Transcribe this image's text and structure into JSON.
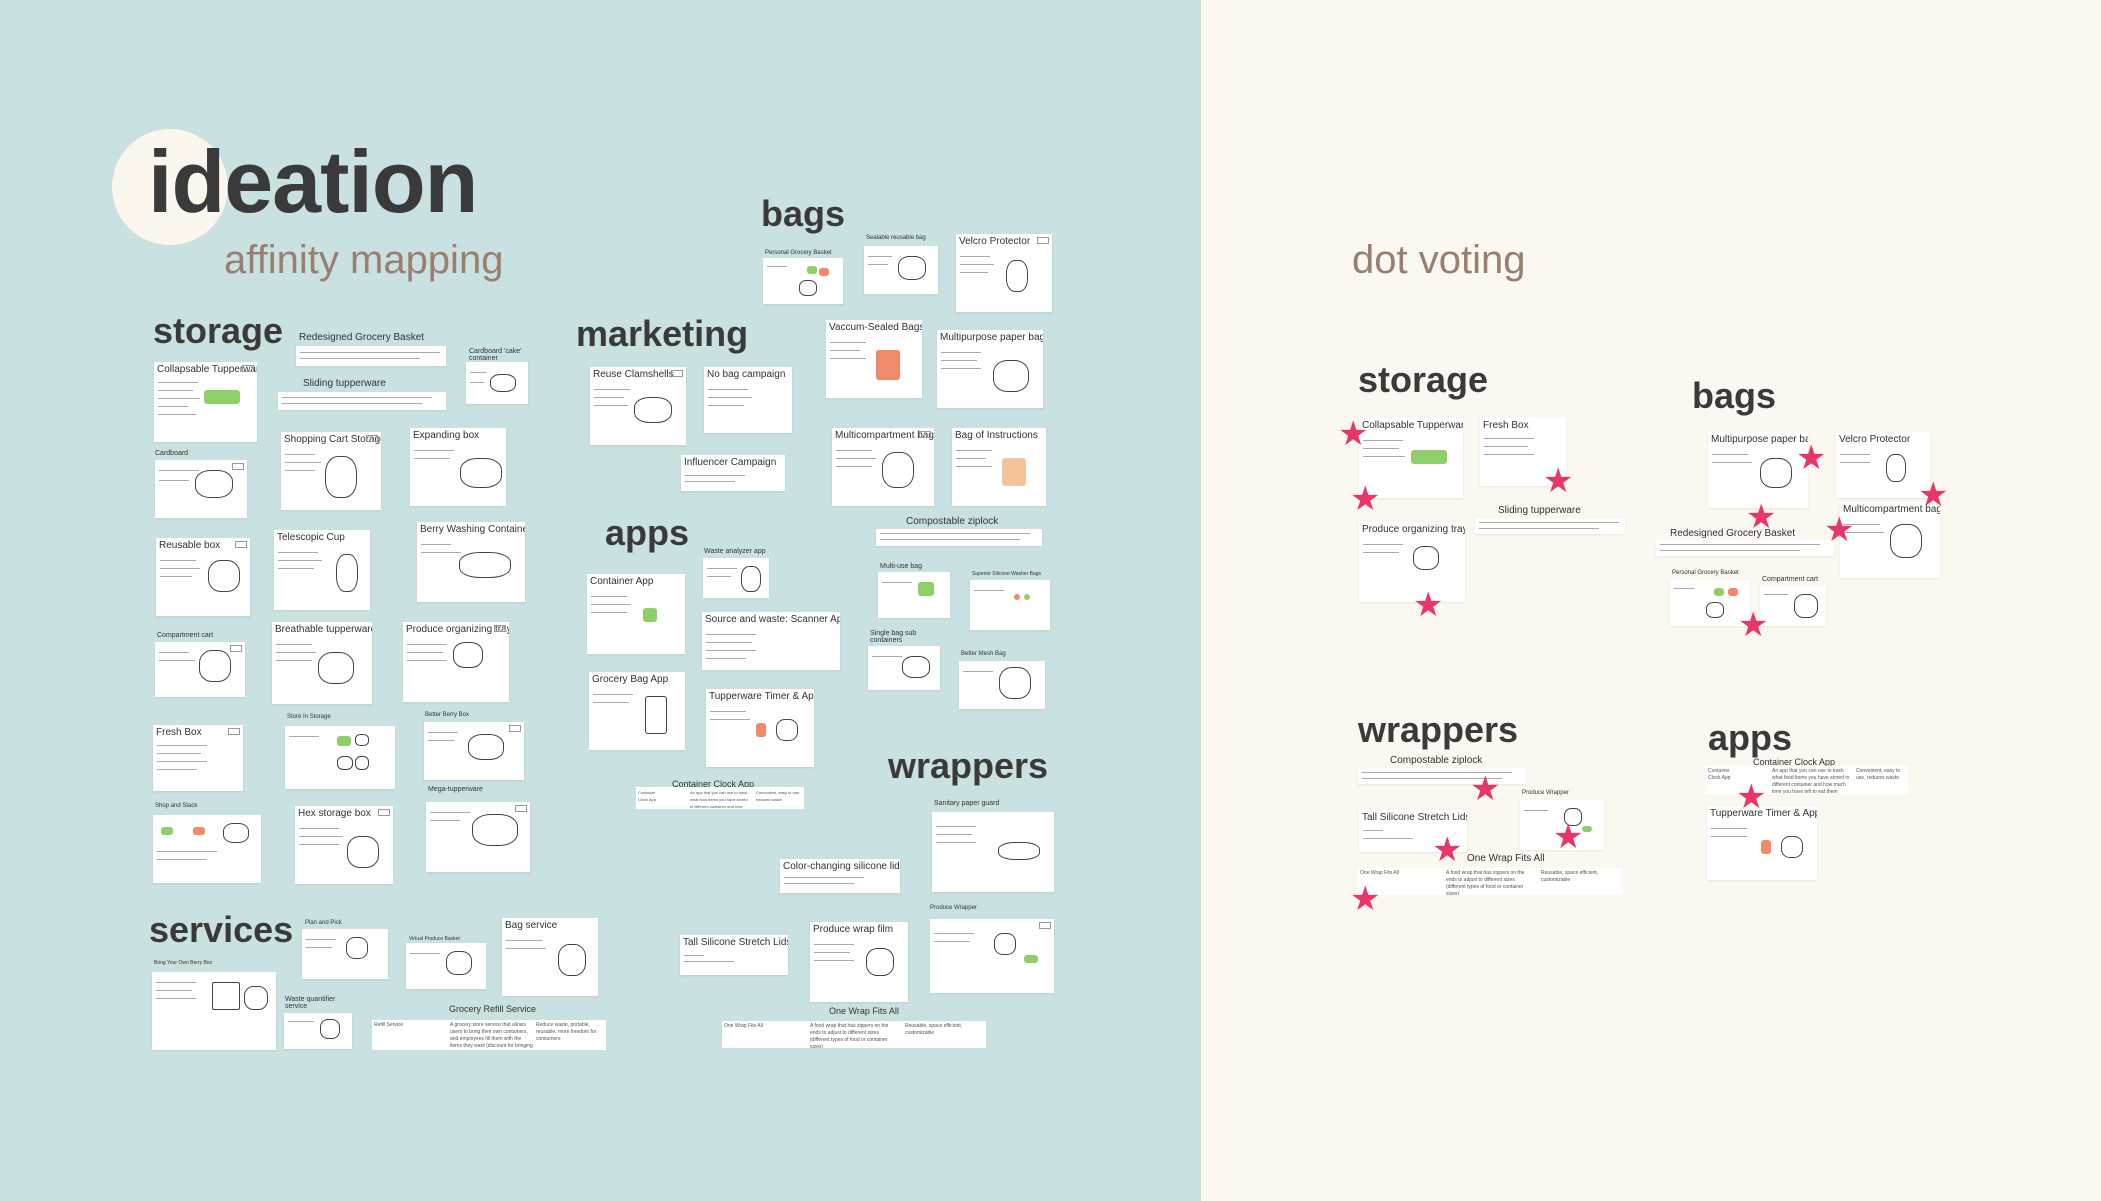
{
  "title": "ideation",
  "subtitle_left": "affinity mapping",
  "subtitle_right": "dot voting",
  "colors": {
    "left_bg": "#c9e1e0",
    "right_bg": "#fbf7f1",
    "star": "#e9366a",
    "heading": "#3a3a3a",
    "subtitle": "#9a7f70"
  },
  "groups": {
    "storage": "storage",
    "marketing": "marketing",
    "bags": "bags",
    "apps": "apps",
    "wrappers": "wrappers",
    "services": "services"
  },
  "left_cards": {
    "collapsable_tupperware": "Collapsable Tupperware",
    "redesigned_grocery_basket": "Redesigned Grocery Basket",
    "cardboard_cake": "Cardboard 'cake' container",
    "sliding_tupperware": "Sliding tupperware",
    "cardboard": "Cardboard",
    "shopping_cart_storage": "Shopping Cart Storage",
    "expanding_box": "Expanding box",
    "reusable_box": "Reusable box",
    "telescopic_cup": "Telescopic Cup",
    "berry_washing": "Berry Washing Container",
    "compartment_cart": "Compartment cart",
    "breathable_tupperware": "Breathable tupperware",
    "produce_organizing_tray": "Produce organizing tray",
    "fresh_box": "Fresh Box",
    "store_in_storage": "Store In Storage",
    "better_berry_box": "Better Berry Box",
    "shop_and_stack": "Shop and Stack",
    "hex_storage_box": "Hex storage box",
    "mega_tupperware": "Mega-tupperware",
    "reuse_clamshells": "Reuse Clamshells",
    "no_bag_campaign": "No bag campaign",
    "influencer_campaign": "Influencer Campaign",
    "personal_grocery_basket": "Personal Grocery Basket",
    "sealable_reusable_bag": "Sealable reusable bag",
    "velcro_protector": "Velcro Protector",
    "vaccum_sealed_bags": "Vaccum-Sealed Bags",
    "multipurpose_paper_bag": "Multipurpose paper bag",
    "multicompartment_bag": "Multicompartment bag",
    "bag_of_instructions": "Bag of Instructions",
    "compostable_ziplock": "Compostable ziplock",
    "waste_analyzer_app": "Waste analyzer app",
    "container_app": "Container App",
    "multi_use_bag": "Multi-use bag",
    "superior_silicone": "Superior Silicone Washer Bags",
    "source_and_waste": "Source and waste: Scanner App",
    "single_bag_sub": "Single bag sub containers",
    "better_mesh_bag": "Better Mesh Bag",
    "grocery_bag_app": "Grocery Bag App",
    "tupperware_timer": "Tupperware Timer & App",
    "container_clock_app": "Container Clock App",
    "sanitary_paper_guard": "Sanitary paper guard",
    "color_changing_lids": "Color-changing silicone lids",
    "produce_wrapper": "Produce Wrapper",
    "tall_silicone": "Tall Silicone Stretch Lids",
    "produce_wrap_film": "Produce wrap film",
    "one_wrap_fits_all": "One Wrap Fits All",
    "plan_and_pick": "Plan and Pick",
    "virtual_produce_basket": "Virtual Produce Basket",
    "bag_service": "Bag service",
    "bring_your_own": "Bring Your Own Berry Box",
    "waste_quantifier": "Waste quantifier service",
    "grocery_refill_service": "Grocery Refill Service"
  },
  "row_text": {
    "clock_a": "An app that you can use to track what food items you have stored in different container and how much time you have left to eat them before they go bad.",
    "clock_b": "Convenient, easy to use, reduces waste.",
    "refill_a": "A grocery store service that allows users to bring their own containers, and employees fill them with the items they want (discount for bringing their own packaging)",
    "refill_b": "Reduce waste, portable, reusable, more freedom for consumers",
    "wrap_a": "A food wrap that has zippers on the ends to adjust to different sizes (different types of food or container sizes)",
    "wrap_b": "Reusable, space efficient, customizable",
    "refill_label": "Refill Service",
    "wrap_label": "One Wrap Fits All",
    "clock_label": "Container Clock App"
  },
  "right_groups": {
    "storage": "storage",
    "bags": "bags",
    "wrappers": "wrappers",
    "apps": "apps"
  },
  "right_cards": {
    "collapsable_tupperware": "Collapsable Tupperware",
    "fresh_box": "Fresh Box",
    "sliding_tupperware": "Sliding tupperware",
    "produce_organizing_tray": "Produce organizing tray",
    "multipurpose_paper_bag": "Multipurpose paper bag",
    "velcro_protector": "Velcro Protector",
    "redesigned_grocery_basket": "Redesigned Grocery Basket",
    "multicompartment_bag": "Multicompartment bag",
    "personal_grocery_basket": "Personal Grocery Basket",
    "compartment_cart": "Compartment cart",
    "compostable_ziplock": "Compostable ziplock",
    "tall_silicone": "Tall Silicone Stretch Lids",
    "produce_wrapper": "Produce Wrapper",
    "one_wrap_fits_all": "One Wrap Fits All",
    "container_clock_app": "Container Clock App",
    "tupperware_timer": "Tupperware Timer & App"
  }
}
